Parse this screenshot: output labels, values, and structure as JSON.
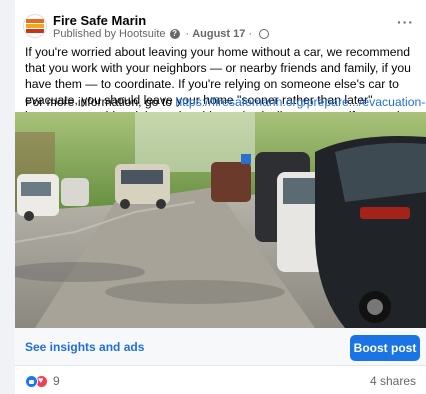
{
  "post": {
    "page_name": "Fire Safe Marin",
    "published_by": "Published by Hootsuite",
    "date": "August 17",
    "separator": "·",
    "more_label": "···",
    "body": "If you're worried about leaving your home without a car, we recommend that you work with your neighbors — or nearby friends and family, if you have them — to coordinate. If you're relying on someone else's car to evacuate, you should leave your home \"sooner rather than later\" because your ride might not be able to physically get to you if you wait too long.",
    "link_prefix": "For more information, go to ",
    "link_text": "https://firesafemarin.org/prepare.../evacuation-guide/..."
  },
  "actions": {
    "insights_label": "See insights and ads",
    "boost_label": "Boost post"
  },
  "engagement": {
    "reaction_count": "9",
    "shares": "4 shares"
  },
  "colors": {
    "link": "#216fdb",
    "boost_button": "#1b74e4",
    "like": "#1877f2",
    "love": "#f33e58"
  },
  "icons": [
    "page-logo-icon",
    "help-icon",
    "globe-icon",
    "more-options-icon",
    "like-reaction-icon",
    "love-reaction-icon"
  ]
}
